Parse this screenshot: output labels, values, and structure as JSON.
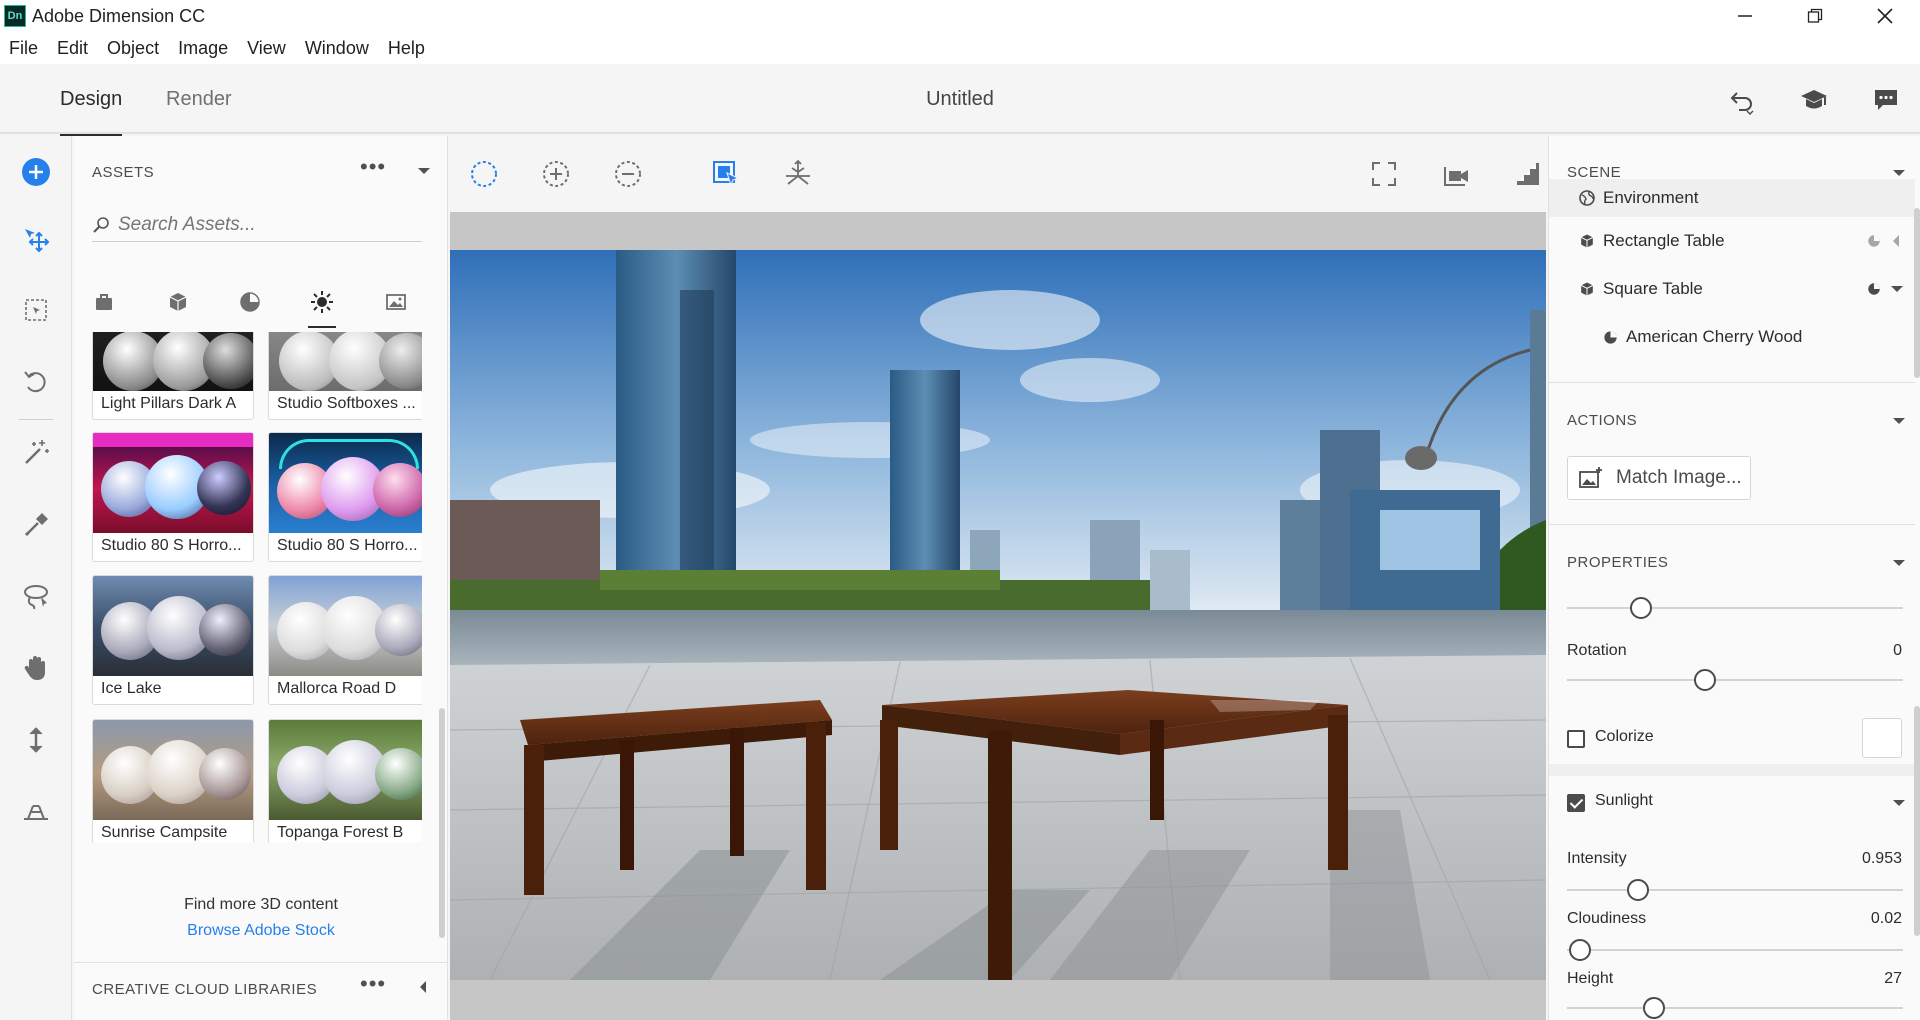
{
  "titlebar": {
    "logo": "Dn",
    "title": "Adobe Dimension CC",
    "controls": [
      "minimize-icon",
      "restore-icon",
      "close-icon"
    ]
  },
  "menubar": {
    "items": [
      "File",
      "Edit",
      "Object",
      "Image",
      "View",
      "Window",
      "Help"
    ]
  },
  "header": {
    "tabs": [
      {
        "label": "Design",
        "active": true
      },
      {
        "label": "Render",
        "active": false
      }
    ],
    "document_title": "Untitled",
    "icons": [
      "undo-icon",
      "learn-icon",
      "feedback-icon"
    ]
  },
  "left_tools": [
    "add-icon",
    "select-move-icon",
    "selection-icon",
    "undo-rotate-icon",
    "magic-wand-icon",
    "eyedropper-icon",
    "lasso-icon",
    "hand-pan-icon",
    "dolly-icon",
    "horizon-icon"
  ],
  "assets": {
    "heading": "ASSETS",
    "search_placeholder": "Search Assets...",
    "categories": [
      "bag-icon",
      "model-icon",
      "material-icon",
      "light-icon",
      "image-icon"
    ],
    "active_category": "light-icon",
    "items": [
      {
        "label": "Light Pillars Dark A"
      },
      {
        "label": "Studio Softboxes ..."
      },
      {
        "label": "Studio 80 S Horro..."
      },
      {
        "label": "Studio 80 S Horro..."
      },
      {
        "label": "Ice Lake"
      },
      {
        "label": "Mallorca Road D"
      },
      {
        "label": "Sunrise Campsite"
      },
      {
        "label": "Topanga Forest B"
      }
    ],
    "find_more": "Find more 3D content",
    "browse_link": "Browse Adobe Stock",
    "libraries_heading": "CREATIVE CLOUD LIBRARIES"
  },
  "viewport_toolbar": {
    "left": [
      "ellipse-select-icon",
      "add-select-icon",
      "subtract-select-icon",
      "frame-select-icon",
      "snap-icon"
    ],
    "right": [
      "fit-view-icon",
      "camera-bookmark-icon",
      "render-preview-icon"
    ]
  },
  "scene_panel": {
    "heading": "SCENE",
    "items": [
      {
        "label": "Environment",
        "icon": "environment-icon",
        "indent": 0
      },
      {
        "label": "Rectangle Table",
        "icon": "model-icon",
        "indent": 0
      },
      {
        "label": "Square Table",
        "icon": "model-icon",
        "indent": 0
      },
      {
        "label": "American Cherry Wood",
        "icon": "material-icon",
        "indent": 1
      }
    ]
  },
  "actions_panel": {
    "heading": "ACTIONS",
    "match_image": "Match Image..."
  },
  "properties_panel": {
    "heading": "PROPERTIES",
    "top_slider": {
      "fraction": 0.22
    },
    "rotation": {
      "label": "Rotation",
      "value": "0",
      "fraction": 0.41
    },
    "colorize": {
      "label": "Colorize",
      "checked": false
    },
    "sunlight": {
      "label": "Sunlight",
      "checked": true
    },
    "intensity": {
      "label": "Intensity",
      "value": "0.953",
      "fraction": 0.21
    },
    "cloudiness": {
      "label": "Cloudiness",
      "value": "0.02",
      "fraction": 0.04
    },
    "height": {
      "label": "Height",
      "value": "27",
      "fraction": 0.26
    }
  },
  "colors": {
    "accent": "#2680eb",
    "wood": "#5a2a12",
    "sky": "#3c7cc2"
  }
}
